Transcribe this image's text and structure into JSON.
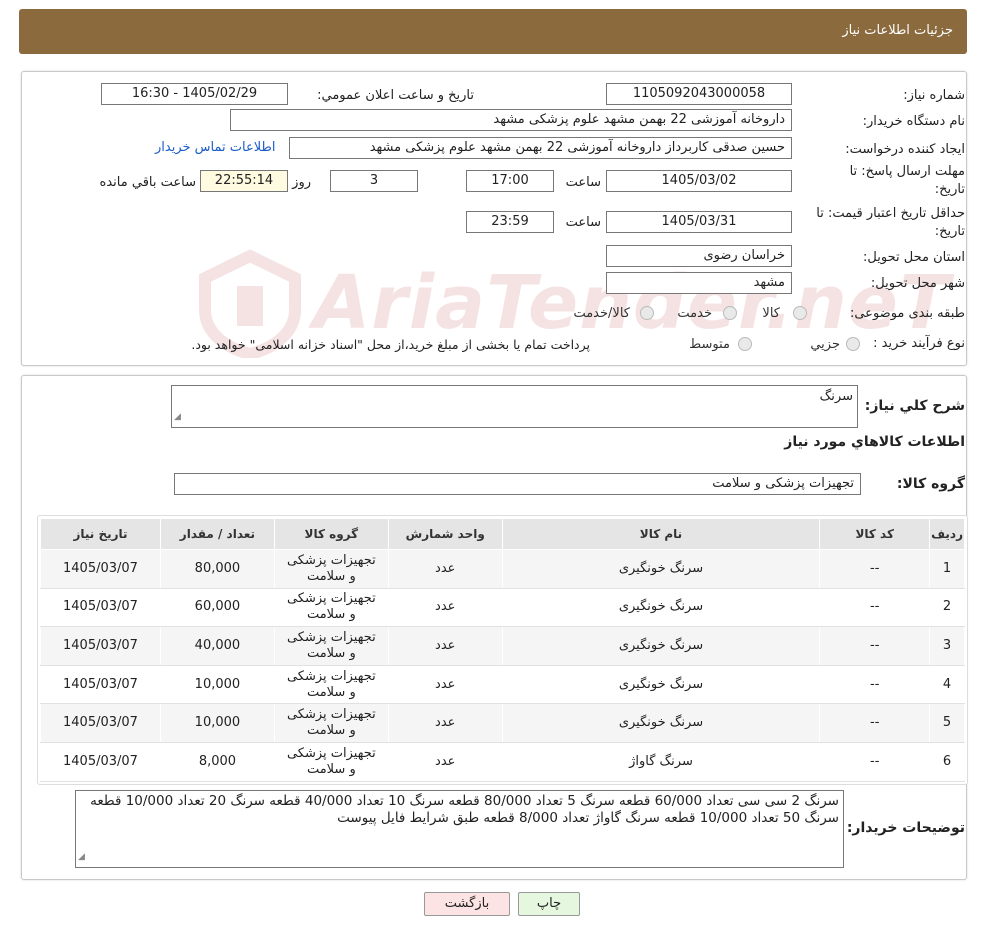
{
  "header": {
    "title": "جزئيات اطلاعات نياز"
  },
  "watermark": {
    "text": "AriaTender.neT"
  },
  "form": {
    "need_number_label": "شماره نياز:",
    "need_number": "1105092043000058",
    "announce_label": "تاريخ و ساعت اعلان عمومي:",
    "announce_value": "1405/02/29 - 16:30",
    "buyer_org_label": "نام دستگاه خريدار:",
    "buyer_org": "داروخانه آموزشی 22 بهمن مشهد   علوم پزشکی مشهد",
    "creator_label": "ايجاد کننده درخواست:",
    "creator": "حسین صدقی کاربرداز داروخانه آموزشی 22 بهمن مشهد   علوم پزشکی مشهد",
    "contact_link": "اطلاعات تماس خريدار",
    "reply_deadline_label_1": "مهلت ارسال پاسخ: تا",
    "reply_deadline_label_2": "تاريخ:",
    "reply_date": "1405/03/02",
    "time_label": "ساعت",
    "reply_time": "17:00",
    "days_value": "3",
    "days_label": "روز و",
    "remaining_time": "22:55:14",
    "remaining_label": "ساعت باقي مانده",
    "min_validity_label_1": "حداقل تاريخ اعتبار قيمت: تا",
    "min_validity_label_2": "تاريخ:",
    "validity_date": "1405/03/31",
    "validity_time": "23:59",
    "province_label": "استان محل تحويل:",
    "province": "خراسان رضوی",
    "city_label": "شهر محل تحويل:",
    "city": "مشهد",
    "category_label": "طبقه بندی موضوعی:",
    "category_options": [
      "کالا",
      "خدمت",
      "کالا/خدمت"
    ],
    "process_label": "نوع فرآيند خريد :",
    "process_options": [
      "جزيي",
      "متوسط"
    ],
    "payment_note": "پرداخت تمام يا بخشی از مبلغ خريد،از محل \"اسناد خزانه اسلامی\" خواهد بود."
  },
  "details": {
    "summary_label": "شرح کلي نياز:",
    "summary": "سرنگ",
    "goods_info_title": "اطلاعات کالاهاي مورد نياز",
    "goods_group_label": "گروه کالا:",
    "goods_group": "تجهیزات پزشکی و سلامت",
    "table_headers": [
      "رديف",
      "کد کالا",
      "نام کالا",
      "واحد شمارش",
      "گروه کالا",
      "تعداد / مقدار",
      "تاريخ نياز"
    ],
    "rows": [
      [
        "1",
        "--",
        "سرنگ خونگیری",
        "عدد",
        "تجهیزات پزشکی و سلامت",
        "80,000",
        "1405/03/07"
      ],
      [
        "2",
        "--",
        "سرنگ خونگیری",
        "عدد",
        "تجهیزات پزشکی و سلامت",
        "60,000",
        "1405/03/07"
      ],
      [
        "3",
        "--",
        "سرنگ خونگیری",
        "عدد",
        "تجهیزات پزشکی و سلامت",
        "40,000",
        "1405/03/07"
      ],
      [
        "4",
        "--",
        "سرنگ خونگیری",
        "عدد",
        "تجهیزات پزشکی و سلامت",
        "10,000",
        "1405/03/07"
      ],
      [
        "5",
        "--",
        "سرنگ خونگیری",
        "عدد",
        "تجهیزات پزشکی و سلامت",
        "10,000",
        "1405/03/07"
      ],
      [
        "6",
        "--",
        "سرنگ گاواژ",
        "عدد",
        "تجهیزات پزشکی و سلامت",
        "8,000",
        "1405/03/07"
      ]
    ],
    "buyer_notes_label": "توضيحات خريدار:",
    "buyer_notes": "سرنگ 2 سی سی تعداد 60/000 قطعه سرنگ 5 تعداد 80/000 قطعه سرنگ 10 تعداد 40/000 قطعه سرنگ 20 تعداد 10/000 قطعه سرنگ 50 تعداد 10/000 قطعه سرنگ گاواژ تعداد 8/000 قطعه طبق شرایط فایل پیوست"
  },
  "buttons": {
    "print": "چاپ",
    "back": "بازگشت"
  }
}
